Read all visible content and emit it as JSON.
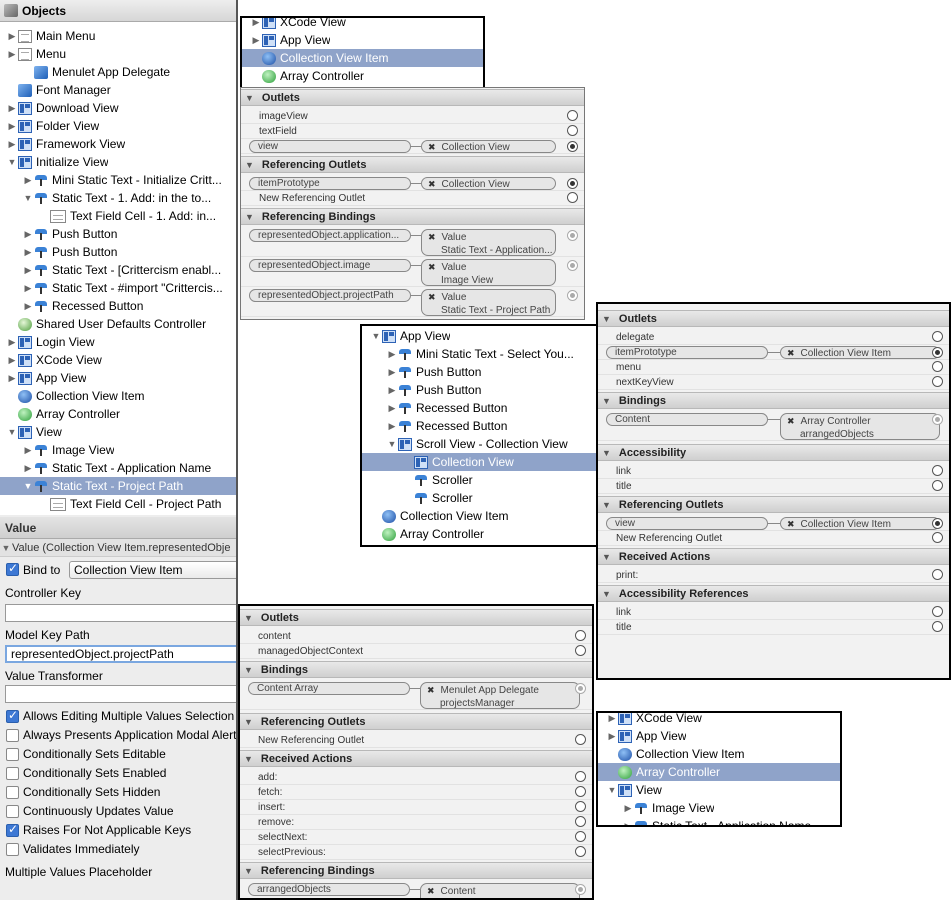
{
  "objects_panel": {
    "title": "Objects",
    "items": [
      {
        "label": "Main Menu",
        "icon": "document-icon",
        "disclosure": "right"
      },
      {
        "label": "Menu",
        "icon": "document-icon",
        "disclosure": "right"
      },
      {
        "label": "Menulet App Delegate",
        "icon": "cube-icon",
        "disclosure": ""
      },
      {
        "label": "Font Manager",
        "icon": "cube-icon",
        "disclosure": ""
      },
      {
        "label": "Download View",
        "icon": "view-icon",
        "disclosure": "right"
      },
      {
        "label": "Folder View",
        "icon": "view-icon",
        "disclosure": "right"
      },
      {
        "label": "Framework View",
        "icon": "view-icon",
        "disclosure": "right"
      },
      {
        "label": "Initialize View",
        "icon": "view-icon",
        "disclosure": "down"
      },
      {
        "label": "Mini Static Text - Initialize Critt...",
        "icon": "button-icon",
        "disclosure": "right"
      },
      {
        "label": "Static Text - 1. Add:   in the to...",
        "icon": "button-icon",
        "disclosure": "down"
      },
      {
        "label": "Text Field Cell - 1. Add:   in...",
        "icon": "cell-icon",
        "disclosure": ""
      },
      {
        "label": "Push Button",
        "icon": "button-icon",
        "disclosure": "right"
      },
      {
        "label": "Push Button",
        "icon": "button-icon",
        "disclosure": "right"
      },
      {
        "label": "Static Text - [Crittercism enabl...",
        "icon": "button-icon",
        "disclosure": "right"
      },
      {
        "label": "Static Text - #import \"Crittercis...",
        "icon": "button-icon",
        "disclosure": "right"
      },
      {
        "label": "Recessed Button",
        "icon": "button-icon",
        "disclosure": "right"
      },
      {
        "label": "Shared User Defaults Controller",
        "icon": "shared-defaults-icon",
        "disclosure": ""
      },
      {
        "label": "Login View",
        "icon": "view-icon",
        "disclosure": "right"
      },
      {
        "label": "XCode View",
        "icon": "view-icon",
        "disclosure": "right"
      },
      {
        "label": "App View",
        "icon": "view-icon",
        "disclosure": "right"
      },
      {
        "label": "Collection View Item",
        "icon": "collection-item-icon",
        "disclosure": ""
      },
      {
        "label": "Array Controller",
        "icon": "array-controller-icon",
        "disclosure": ""
      },
      {
        "label": "View",
        "icon": "view-icon",
        "disclosure": "down"
      },
      {
        "label": "Image View",
        "icon": "button-icon",
        "disclosure": "right"
      },
      {
        "label": "Static Text - Application Name",
        "icon": "button-icon",
        "disclosure": "right"
      },
      {
        "label": "Static Text - Project Path",
        "icon": "button-icon",
        "disclosure": "down",
        "selected": true
      },
      {
        "label": "Text Field Cell - Project Path",
        "icon": "cell-icon",
        "disclosure": ""
      }
    ]
  },
  "bindings_panel": {
    "header": "Value",
    "subheader": "Value (Collection View Item.representedObje",
    "bind_to_label": "Bind to",
    "bind_to_checked": true,
    "bind_to_value": "Collection View Item",
    "controller_key_label": "Controller Key",
    "controller_key_value": "",
    "model_key_path_label": "Model Key Path",
    "model_key_path_value": "representedObject.projectPath",
    "value_transformer_label": "Value Transformer",
    "value_transformer_value": "",
    "options": [
      {
        "label": "Allows Editing Multiple Values Selection",
        "checked": true
      },
      {
        "label": "Always Presents Application Modal Alert",
        "checked": false
      },
      {
        "label": "Conditionally Sets Editable",
        "checked": false
      },
      {
        "label": "Conditionally Sets Enabled",
        "checked": false
      },
      {
        "label": "Conditionally Sets Hidden",
        "checked": false
      },
      {
        "label": "Continuously Updates Value",
        "checked": false
      },
      {
        "label": "Raises For Not Applicable Keys",
        "checked": true
      },
      {
        "label": "Validates Immediately",
        "checked": false
      }
    ],
    "multiple_values_placeholder_label": "Multiple Values Placeholder"
  },
  "tree_top": {
    "items": [
      {
        "label": "XCode View",
        "icon": "view-icon",
        "disclosure": "right"
      },
      {
        "label": "App View",
        "icon": "view-icon",
        "disclosure": "right"
      },
      {
        "label": "Collection View Item",
        "icon": "collection-item-icon",
        "disclosure": "",
        "selected": true
      },
      {
        "label": "Array Controller",
        "icon": "array-controller-icon",
        "disclosure": ""
      }
    ]
  },
  "conn_collection_item": {
    "sections": [
      {
        "title": "Outlets",
        "rows": [
          {
            "name": "imageView",
            "connected": false
          },
          {
            "name": "textField",
            "connected": false
          },
          {
            "name": "view",
            "connected": true,
            "target": "Collection View"
          }
        ]
      },
      {
        "title": "Referencing Outlets",
        "rows": [
          {
            "name": "itemPrototype",
            "connected": true,
            "target": "Collection View"
          },
          {
            "name": "New Referencing Outlet",
            "connected": false
          }
        ]
      },
      {
        "title": "Referencing Bindings",
        "rows": [
          {
            "name": "representedObject.application...",
            "connected": true,
            "target": "Value",
            "target2": "Static Text - Application..."
          },
          {
            "name": "representedObject.image",
            "connected": true,
            "target": "Value",
            "target2": "Image View"
          },
          {
            "name": "representedObject.projectPath",
            "connected": true,
            "target": "Value",
            "target2": "Static Text - Project Path"
          }
        ]
      }
    ]
  },
  "tree_middle": {
    "items": [
      {
        "label": "App View",
        "icon": "view-icon",
        "disclosure": "down"
      },
      {
        "label": "Mini Static Text - Select You...",
        "icon": "button-icon",
        "disclosure": "right"
      },
      {
        "label": "Push Button",
        "icon": "button-icon",
        "disclosure": "right"
      },
      {
        "label": "Push Button",
        "icon": "button-icon",
        "disclosure": "right"
      },
      {
        "label": "Recessed Button",
        "icon": "button-icon",
        "disclosure": "right"
      },
      {
        "label": "Recessed Button",
        "icon": "button-icon",
        "disclosure": "right"
      },
      {
        "label": "Scroll View - Collection View",
        "icon": "view-icon",
        "disclosure": "down"
      },
      {
        "label": "Collection View",
        "icon": "view-icon",
        "disclosure": "",
        "selected": true
      },
      {
        "label": "Scroller",
        "icon": "button-icon",
        "disclosure": ""
      },
      {
        "label": "Scroller",
        "icon": "button-icon",
        "disclosure": ""
      },
      {
        "label": "Collection View Item",
        "icon": "collection-item-icon",
        "disclosure": ""
      },
      {
        "label": "Array Controller",
        "icon": "array-controller-icon",
        "disclosure": ""
      }
    ]
  },
  "conn_collection_view": {
    "sections": [
      {
        "title": "Outlets",
        "rows": [
          {
            "name": "delegate",
            "connected": false
          },
          {
            "name": "itemPrototype",
            "connected": true,
            "target": "Collection View Item"
          },
          {
            "name": "menu",
            "connected": false
          },
          {
            "name": "nextKeyView",
            "connected": false
          }
        ]
      },
      {
        "title": "Bindings",
        "rows": [
          {
            "name": "Content",
            "connected": true,
            "target": "Array Controller",
            "target2": "arrangedObjects"
          }
        ]
      },
      {
        "title": "Accessibility",
        "rows": [
          {
            "name": "link",
            "connected": false
          },
          {
            "name": "title",
            "connected": false
          }
        ]
      },
      {
        "title": "Referencing Outlets",
        "rows": [
          {
            "name": "view",
            "connected": true,
            "target": "Collection View Item"
          },
          {
            "name": "New Referencing Outlet",
            "connected": false
          }
        ]
      },
      {
        "title": "Received Actions",
        "rows": [
          {
            "name": "print:",
            "connected": false
          }
        ]
      },
      {
        "title": "Accessibility References",
        "rows": [
          {
            "name": "link",
            "connected": false
          },
          {
            "name": "title",
            "connected": false
          }
        ]
      }
    ]
  },
  "conn_array_controller": {
    "sections": [
      {
        "title": "Outlets",
        "rows": [
          {
            "name": "content",
            "connected": false
          },
          {
            "name": "managedObjectContext",
            "connected": false
          }
        ]
      },
      {
        "title": "Bindings",
        "rows": [
          {
            "name": "Content Array",
            "connected": true,
            "target": "Menulet App Delegate",
            "target2": "projectsManager"
          }
        ]
      },
      {
        "title": "Referencing Outlets",
        "rows": [
          {
            "name": "New Referencing Outlet",
            "connected": false
          }
        ]
      },
      {
        "title": "Received Actions",
        "rows": [
          {
            "name": "add:",
            "connected": false
          },
          {
            "name": "fetch:",
            "connected": false
          },
          {
            "name": "insert:",
            "connected": false
          },
          {
            "name": "remove:",
            "connected": false
          },
          {
            "name": "selectNext:",
            "connected": false
          },
          {
            "name": "selectPrevious:",
            "connected": false
          }
        ]
      },
      {
        "title": "Referencing Bindings",
        "rows": [
          {
            "name": "arrangedObjects",
            "connected": true,
            "target": "Content",
            "target2": "Collection View"
          }
        ]
      }
    ]
  },
  "tree_bottom": {
    "items": [
      {
        "label": "XCode View",
        "icon": "view-icon",
        "disclosure": "right"
      },
      {
        "label": "App View",
        "icon": "view-icon",
        "disclosure": "right"
      },
      {
        "label": "Collection View Item",
        "icon": "collection-item-icon",
        "disclosure": ""
      },
      {
        "label": "Array Controller",
        "icon": "array-controller-icon",
        "disclosure": "",
        "selected": true
      },
      {
        "label": "View",
        "icon": "view-icon",
        "disclosure": "down"
      },
      {
        "label": "Image View",
        "icon": "button-icon",
        "disclosure": "right"
      },
      {
        "label": "Static Text - Application Name",
        "icon": "button-icon",
        "disclosure": "right"
      }
    ]
  },
  "colors": {
    "selection": "#8fa3c9",
    "section_header": "#d8d8d8",
    "panel_border": "#000000"
  }
}
